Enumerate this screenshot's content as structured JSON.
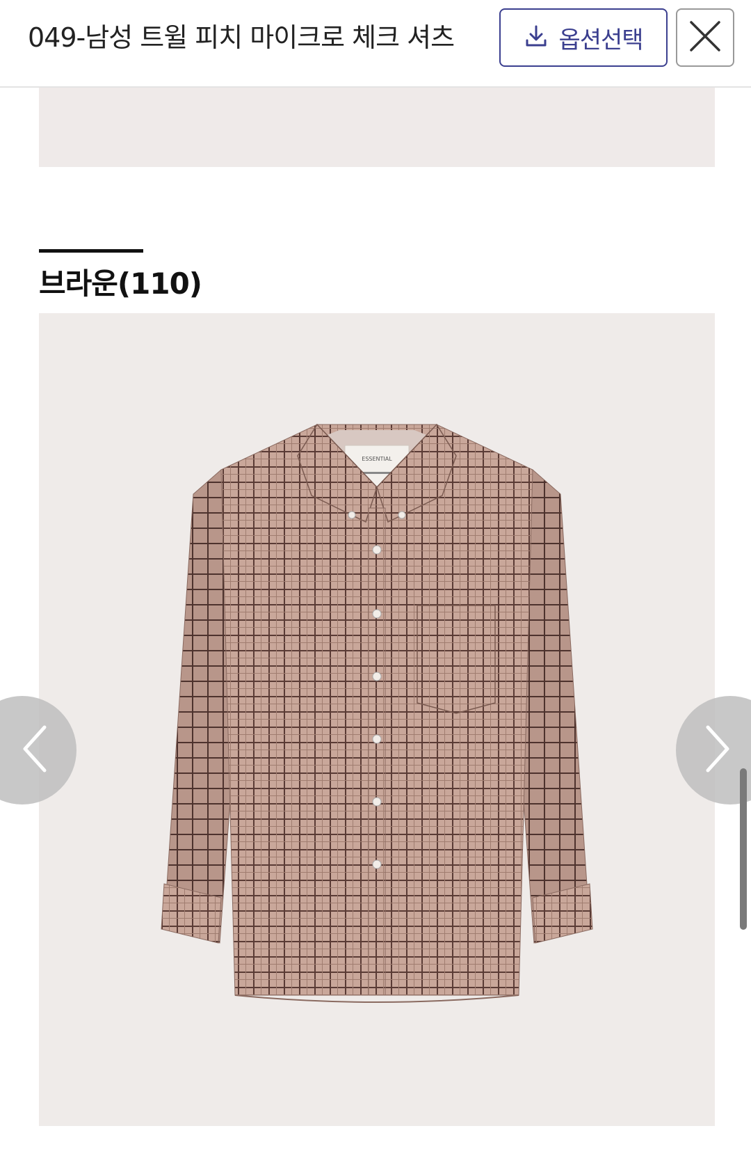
{
  "header": {
    "title": "049-남성 트윌 피치 마이크로 체크 셔츠",
    "option_button_label": "옵션선택",
    "option_button_icon": "download-icon",
    "close_icon": "close-icon",
    "accent_color": "#3b3f8f"
  },
  "section": {
    "title": "브라운(110)"
  },
  "product_image": {
    "description_icon": "checked-shirt-image",
    "label_text": "ESSENTIAL"
  },
  "carousel": {
    "prev_icon": "chevron-left-icon",
    "next_icon": "chevron-right-icon"
  }
}
